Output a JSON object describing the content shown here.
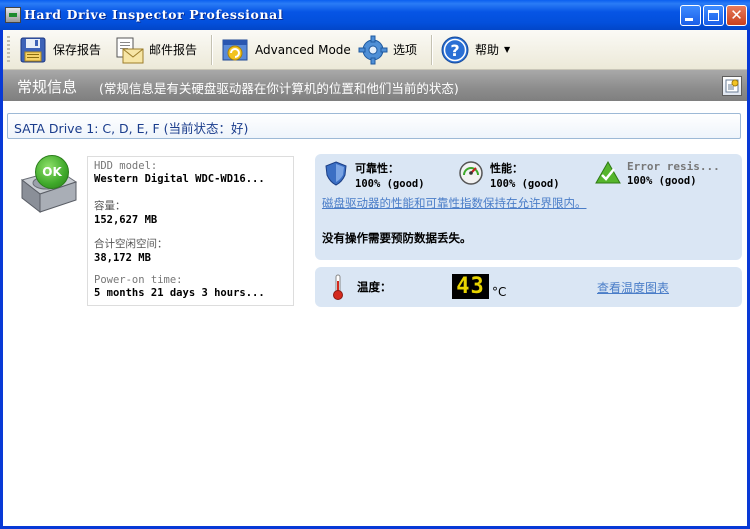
{
  "window": {
    "title": "Hard Drive Inspector Professional"
  },
  "toolbar": {
    "save_report": "保存报告",
    "mail_report": "邮件报告",
    "advanced_mode": "Advanced Mode",
    "options": "选项",
    "help": "帮助"
  },
  "section": {
    "title": "常规信息",
    "subtitle": "(常规信息是有关硬盘驱动器在你计算机的位置和他们当前的状态)"
  },
  "drive": {
    "header": "SATA Drive 1: C, D, E, F (当前状态：好)",
    "status_badge": "OK",
    "info": [
      {
        "label": "HDD model:",
        "value": "Western Digital WDC-WD16..."
      },
      {
        "label": "容量：",
        "value": "152,627 MB"
      },
      {
        "label": "合计空闲空间：",
        "value": "38,172 MB"
      },
      {
        "label": "Power-on time:",
        "value": "5 months 21 days 3 hours..."
      }
    ]
  },
  "metrics": [
    {
      "label": "可靠性：",
      "value": "100% (good)",
      "icon": "shield-icon"
    },
    {
      "label": "性能：",
      "value": "100% (good)",
      "icon": "gauge-icon"
    },
    {
      "label": "Error resis...",
      "value": "100% (good)",
      "icon": "check-triangle-icon"
    }
  ],
  "status": {
    "link": "磁盘驱动器的性能和可靠性指数保持在允许界限内。",
    "message": "没有操作需要预防数据丢失。"
  },
  "temperature": {
    "label": "温度：",
    "value": "43",
    "unit": "°C",
    "chart_link": "查看温度图表"
  },
  "colors": {
    "titlebar": "#0655e5",
    "panel": "#dae6f4",
    "link": "#4a7dc8",
    "section_header": "#8c8c8c",
    "ok_badge": "#3fa92a"
  }
}
